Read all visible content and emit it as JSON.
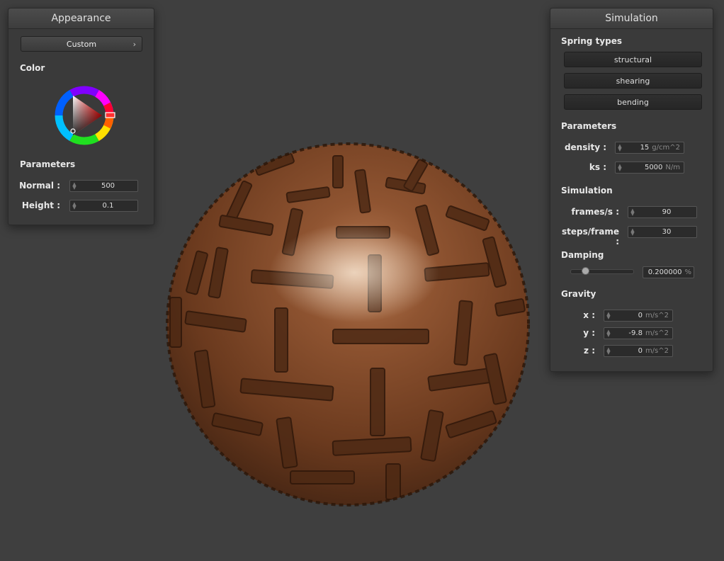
{
  "appearance": {
    "title": "Appearance",
    "preset": "Custom",
    "color_label": "Color",
    "parameters_label": "Parameters",
    "normal_label": "Normal :",
    "normal_value": "500",
    "height_label": "Height :",
    "height_value": "0.1",
    "chevron_icon": "chevron-right-icon"
  },
  "simulation_panel": {
    "title": "Simulation",
    "spring_types_label": "Spring types",
    "spring_buttons": [
      "structural",
      "shearing",
      "bending"
    ],
    "parameters_label": "Parameters",
    "density_label": "density :",
    "density_value": "15",
    "density_unit": "g/cm^2",
    "ks_label": "ks :",
    "ks_value": "5000",
    "ks_unit": "N/m",
    "simulation_label": "Simulation",
    "fps_label": "frames/s :",
    "fps_value": "90",
    "steps_label": "steps/frame :",
    "steps_value": "30",
    "damping_label": "Damping",
    "damping_value": "0.200000",
    "damping_unit": "%",
    "damping_slider_fraction": 0.2,
    "gravity_label": "Gravity",
    "gx_label": "x :",
    "gx_value": "0",
    "gy_label": "y :",
    "gy_value": "-9.8",
    "gz_label": "z :",
    "gz_value": "0",
    "gravity_unit": "m/s^2"
  },
  "colors": {
    "background": "#3f3f3f",
    "panel": "#3a3a3a",
    "sphere_base": "#7a4424",
    "picker_triangle": "#ff0000"
  }
}
